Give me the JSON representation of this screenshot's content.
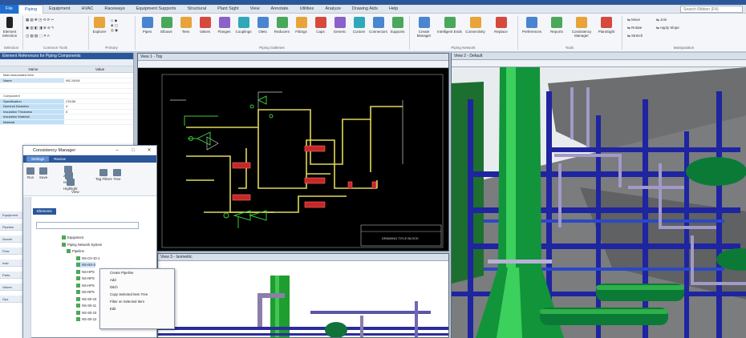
{
  "ribbon_tabs": [
    "File",
    "Piping",
    "Equipment",
    "HVAC",
    "Raceways",
    "Equipment Supports",
    "Structural",
    "Plant Sight",
    "View",
    "Annotate",
    "Utilities",
    "Analyze",
    "Drawing Aids",
    "Help"
  ],
  "search_placeholder": "Search Ribbon (F4)",
  "ribbon": {
    "select_label": "Element Selection",
    "explorer_label": "Explorer",
    "components": [
      "Pipes",
      "Elbows",
      "Tees",
      "Valves",
      "Flanges",
      "Couplings",
      "Olets",
      "Reducers",
      "Fittings",
      "Caps",
      "Generic",
      "Custom",
      "Connectors",
      "Supports"
    ],
    "pn_buttons": [
      "Create Manager",
      "Intelligent Ends",
      "Connectivity",
      "Replace"
    ],
    "tools_buttons": [
      "Preferences",
      "Reports",
      "Consistency Manager",
      "PlantSight"
    ],
    "manip_buttons": [
      "Move",
      "Rotate",
      "Stretch",
      "Join",
      "Apply Slope"
    ],
    "group_labels": [
      "Selection",
      "Common Tools",
      "Primary",
      "Piping Galleries",
      "Piping Network",
      "Tools",
      "Manipulation"
    ]
  },
  "left_panel": {
    "title": "Element References for Piping Components",
    "col_name": "Name",
    "col_value": "Value",
    "rows": [
      {
        "k": "Main Associated Item",
        "v": "",
        "cls": "cat"
      },
      {
        "k": "Name",
        "v": "NS-10001",
        "cls": "sel"
      },
      {
        "k": "",
        "v": "",
        "cls": ""
      },
      {
        "k": "",
        "v": "",
        "cls": ""
      },
      {
        "k": "Component",
        "v": "",
        "cls": "cat"
      },
      {
        "k": "Specification",
        "v": "CS150",
        "cls": "blue"
      },
      {
        "k": "Nominal Diameter",
        "v": "4",
        "cls": "blue"
      },
      {
        "k": "Insulation Thickness",
        "v": "0",
        "cls": "blue"
      },
      {
        "k": "Insulation Material",
        "v": "",
        "cls": "blue"
      },
      {
        "k": "Material",
        "v": "",
        "cls": "blue"
      }
    ],
    "side_items": [
      "Equipment",
      "Pipeline",
      "Nozzle",
      "Flow",
      "Instr",
      "Parts",
      "Valves",
      "Ops"
    ]
  },
  "consistency_manager": {
    "title": "Consistency Manager",
    "tabs": [
      "Settings",
      "Review"
    ],
    "buttons": [
      "Run",
      "Save",
      "Zoom",
      "Isolate",
      "Highlight",
      "Tag Filters",
      "Tree"
    ],
    "group_label": "View",
    "subtab": "Elements",
    "tree": [
      {
        "label": "Equipment",
        "indent": 8,
        "hl": false
      },
      {
        "label": "Piping Network System",
        "indent": 8,
        "hl": false
      },
      {
        "label": "Pipeline",
        "indent": 14,
        "hl": false
      },
      {
        "label": "NS-C0-10-1",
        "indent": 26,
        "hl": false
      },
      {
        "label": "NS-NS-S",
        "indent": 26,
        "hl": true
      },
      {
        "label": "NS-HPS",
        "indent": 26,
        "hl": false
      },
      {
        "label": "NS-NPS",
        "indent": 26,
        "hl": false
      },
      {
        "label": "NS-HPS",
        "indent": 26,
        "hl": false
      },
      {
        "label": "NS-NPS",
        "indent": 26,
        "hl": false
      },
      {
        "label": "NS-S0-10",
        "indent": 26,
        "hl": false
      },
      {
        "label": "NS-S0-11",
        "indent": 26,
        "hl": false
      },
      {
        "label": "NS-S0-10",
        "indent": 26,
        "hl": false
      },
      {
        "label": "NS-S0-12",
        "indent": 26,
        "hl": false
      }
    ]
  },
  "context_menu": [
    "Create Pipeline",
    "Add",
    "Ditch",
    "Copy Selected Item Tree",
    "Filter on Selected Item",
    "Edit"
  ],
  "view2d_title": "View 1 - Top",
  "view3d_title": "View 2 - Default",
  "view3dsmall_title": "View 3 - Isometric",
  "titleblock_text": "DRAWING TITLE BLOCK"
}
